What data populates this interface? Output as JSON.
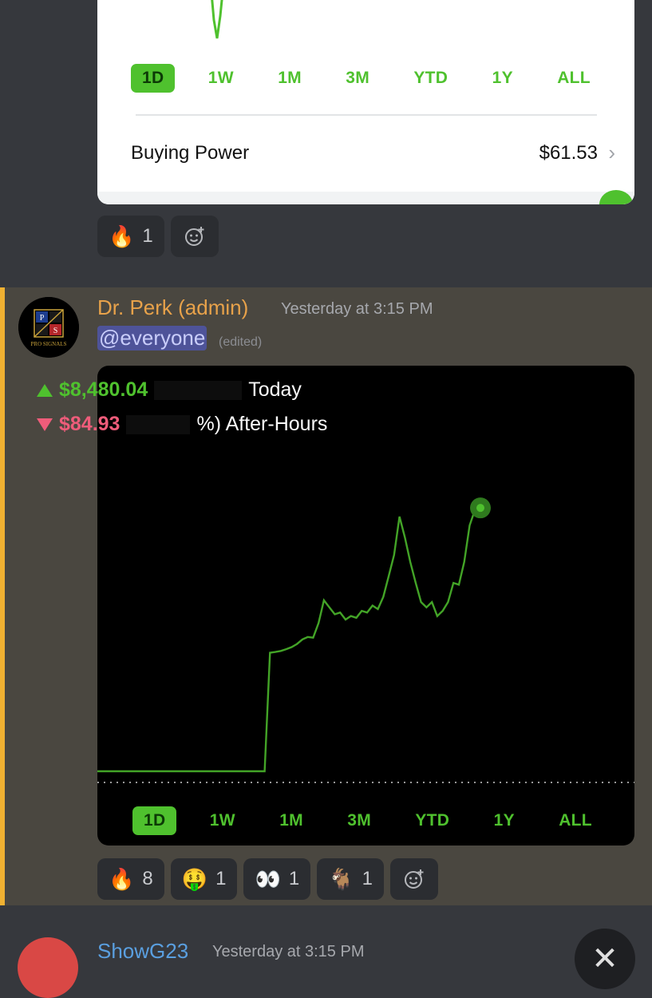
{
  "card1": {
    "ranges": [
      "1D",
      "1W",
      "1M",
      "3M",
      "YTD",
      "1Y",
      "ALL"
    ],
    "active_range": "1D",
    "buying_power_label": "Buying Power",
    "buying_power_value": "$61.53"
  },
  "reactions1": [
    {
      "emoji": "🔥",
      "count": "1"
    }
  ],
  "message": {
    "username": "Dr. Perk (admin)",
    "timestamp": "Yesterday at 3:15 PM",
    "mention": "@everyone",
    "edited": "(edited)",
    "avatar_text": "PRO SIGNALS",
    "avatar_letters": [
      "P",
      "S"
    ]
  },
  "card2": {
    "today_value": "$8,480.04",
    "today_label": "Today",
    "after_value": "$84.93",
    "after_label": "%) After-Hours",
    "ranges": [
      "1D",
      "1W",
      "1M",
      "3M",
      "YTD",
      "1Y",
      "ALL"
    ],
    "active_range": "1D"
  },
  "reactions2": [
    {
      "emoji": "🔥",
      "count": "8"
    },
    {
      "emoji": "🤑",
      "count": "1"
    },
    {
      "emoji": "👀",
      "count": "1"
    },
    {
      "emoji": "🐐",
      "count": "1"
    }
  ],
  "next_message": {
    "username": "ShowG23",
    "timestamp": "Yesterday at 3:15 PM"
  },
  "colors": {
    "gain": "#4fc12e",
    "loss": "#ee5c7a",
    "highlight_bar": "#f0b132",
    "username": "#e8a24a"
  },
  "chart_data": {
    "type": "line",
    "title": "",
    "y": [
      0,
      0,
      0,
      0,
      0,
      0,
      0,
      0,
      0,
      0,
      0,
      0,
      0,
      0,
      0,
      0,
      0,
      0,
      0,
      0,
      0,
      0,
      0,
      0,
      0,
      0,
      0,
      0,
      0,
      0,
      0,
      0,
      3400,
      3420,
      3450,
      3500,
      3560,
      3650,
      3780,
      3850,
      3830,
      4250,
      4900,
      4700,
      4500,
      4550,
      4350,
      4450,
      4400,
      4600,
      4550,
      4750,
      4650,
      5000,
      5600,
      6200,
      7300,
      6700,
      6000,
      5400,
      4850,
      4700,
      4850,
      4450,
      4600,
      4850,
      5400,
      5350,
      6000,
      7050,
      7500,
      7550
    ],
    "grid": false,
    "baseline": "dotted"
  }
}
